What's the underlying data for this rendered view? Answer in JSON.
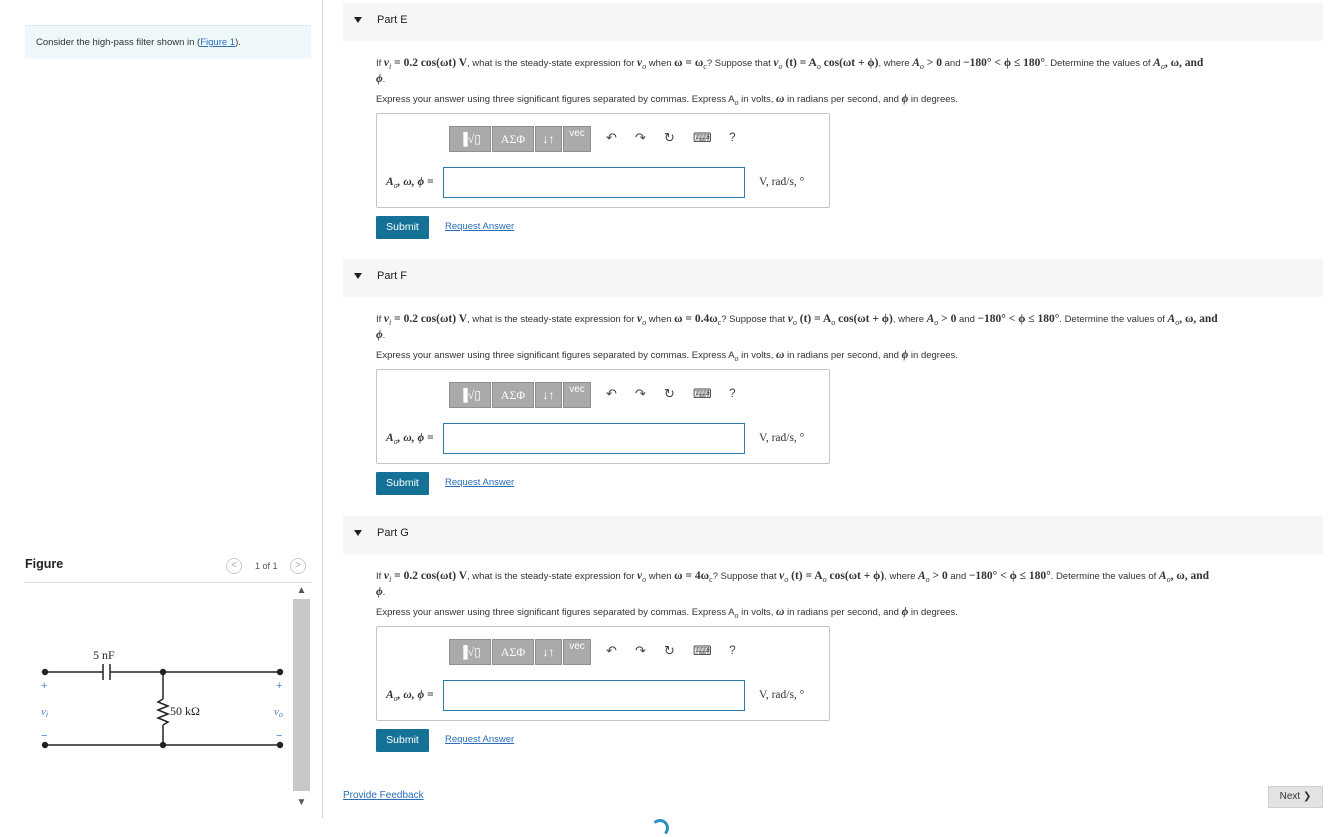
{
  "intro": {
    "prefix": "Consider the high-pass filter shown in (",
    "link": "Figure 1",
    "suffix": ")."
  },
  "figure": {
    "title": "Figure",
    "count": "1 of 1",
    "capacitor_label": "5 nF",
    "resistor_label": "50 kΩ",
    "vi_label": "v",
    "vi_sub": "i",
    "vo_label": "v",
    "vo_sub": "o",
    "plus": "+",
    "minus": "−"
  },
  "toolbar": {
    "templates": "▐√▯",
    "greek": "ΑΣΦ",
    "arrows": "↓↑",
    "vec": "vec",
    "undo": "↶",
    "redo": "↷",
    "reset": "↻",
    "keyboard": "⌨",
    "help": "?"
  },
  "parts": [
    {
      "title": "Part E",
      "question_pre": "If ",
      "condition": "ω = ω",
      "condition_sub": "c",
      "instruction": "Express your answer using three significant figures separated by commas. Express A",
      "answer_label": "A",
      "units": "V, rad/s, °",
      "submit": "Submit",
      "request": "Request Answer"
    },
    {
      "title": "Part F",
      "question_pre": "If ",
      "condition": "ω = 0.4ω",
      "condition_sub": "c",
      "instruction": "Express your answer using three significant figures separated by commas. Express A",
      "answer_label": "A",
      "units": "V, rad/s, °",
      "submit": "Submit",
      "request": "Request Answer"
    },
    {
      "title": "Part G",
      "question_pre": "If ",
      "condition": "ω = 4ω",
      "condition_sub": "c",
      "instruction": "Express your answer using three significant figures separated by commas. Express A",
      "answer_label": "A",
      "units": "V, rad/s, °",
      "submit": "Submit",
      "request": "Request Answer"
    }
  ],
  "q": {
    "vi_expr": "v",
    "vi_sub": "i",
    "eq1": " = 0.2 cos(ωt) V",
    "mid1": ", what is the steady-state expression for ",
    "vo": "v",
    "vo_sub": "o",
    "mid2": " when ",
    "mid3": "? Suppose that ",
    "vot": " (t) = A",
    "cosexpr": " cos(ωt + ϕ)",
    "mid4": ", where ",
    "ao": "A",
    "gt0": " > 0",
    "and": " and ",
    "range": "−180° < ϕ ≤ 180°",
    "mid5": ". Determine the values of ",
    "list_end": ", ω, and",
    "phi": "ϕ",
    "period": ".",
    "ins_mid": " in volts, ",
    "ins_w": "ω",
    "ins_mid2": " in radians per second, and ",
    "ins_phi": "ϕ",
    "ins_end": " in degrees.",
    "ans_rest": ", ω, ϕ =",
    "sub_o": "o"
  },
  "footer": {
    "feedback": "Provide Feedback",
    "next": "Next ❯"
  }
}
